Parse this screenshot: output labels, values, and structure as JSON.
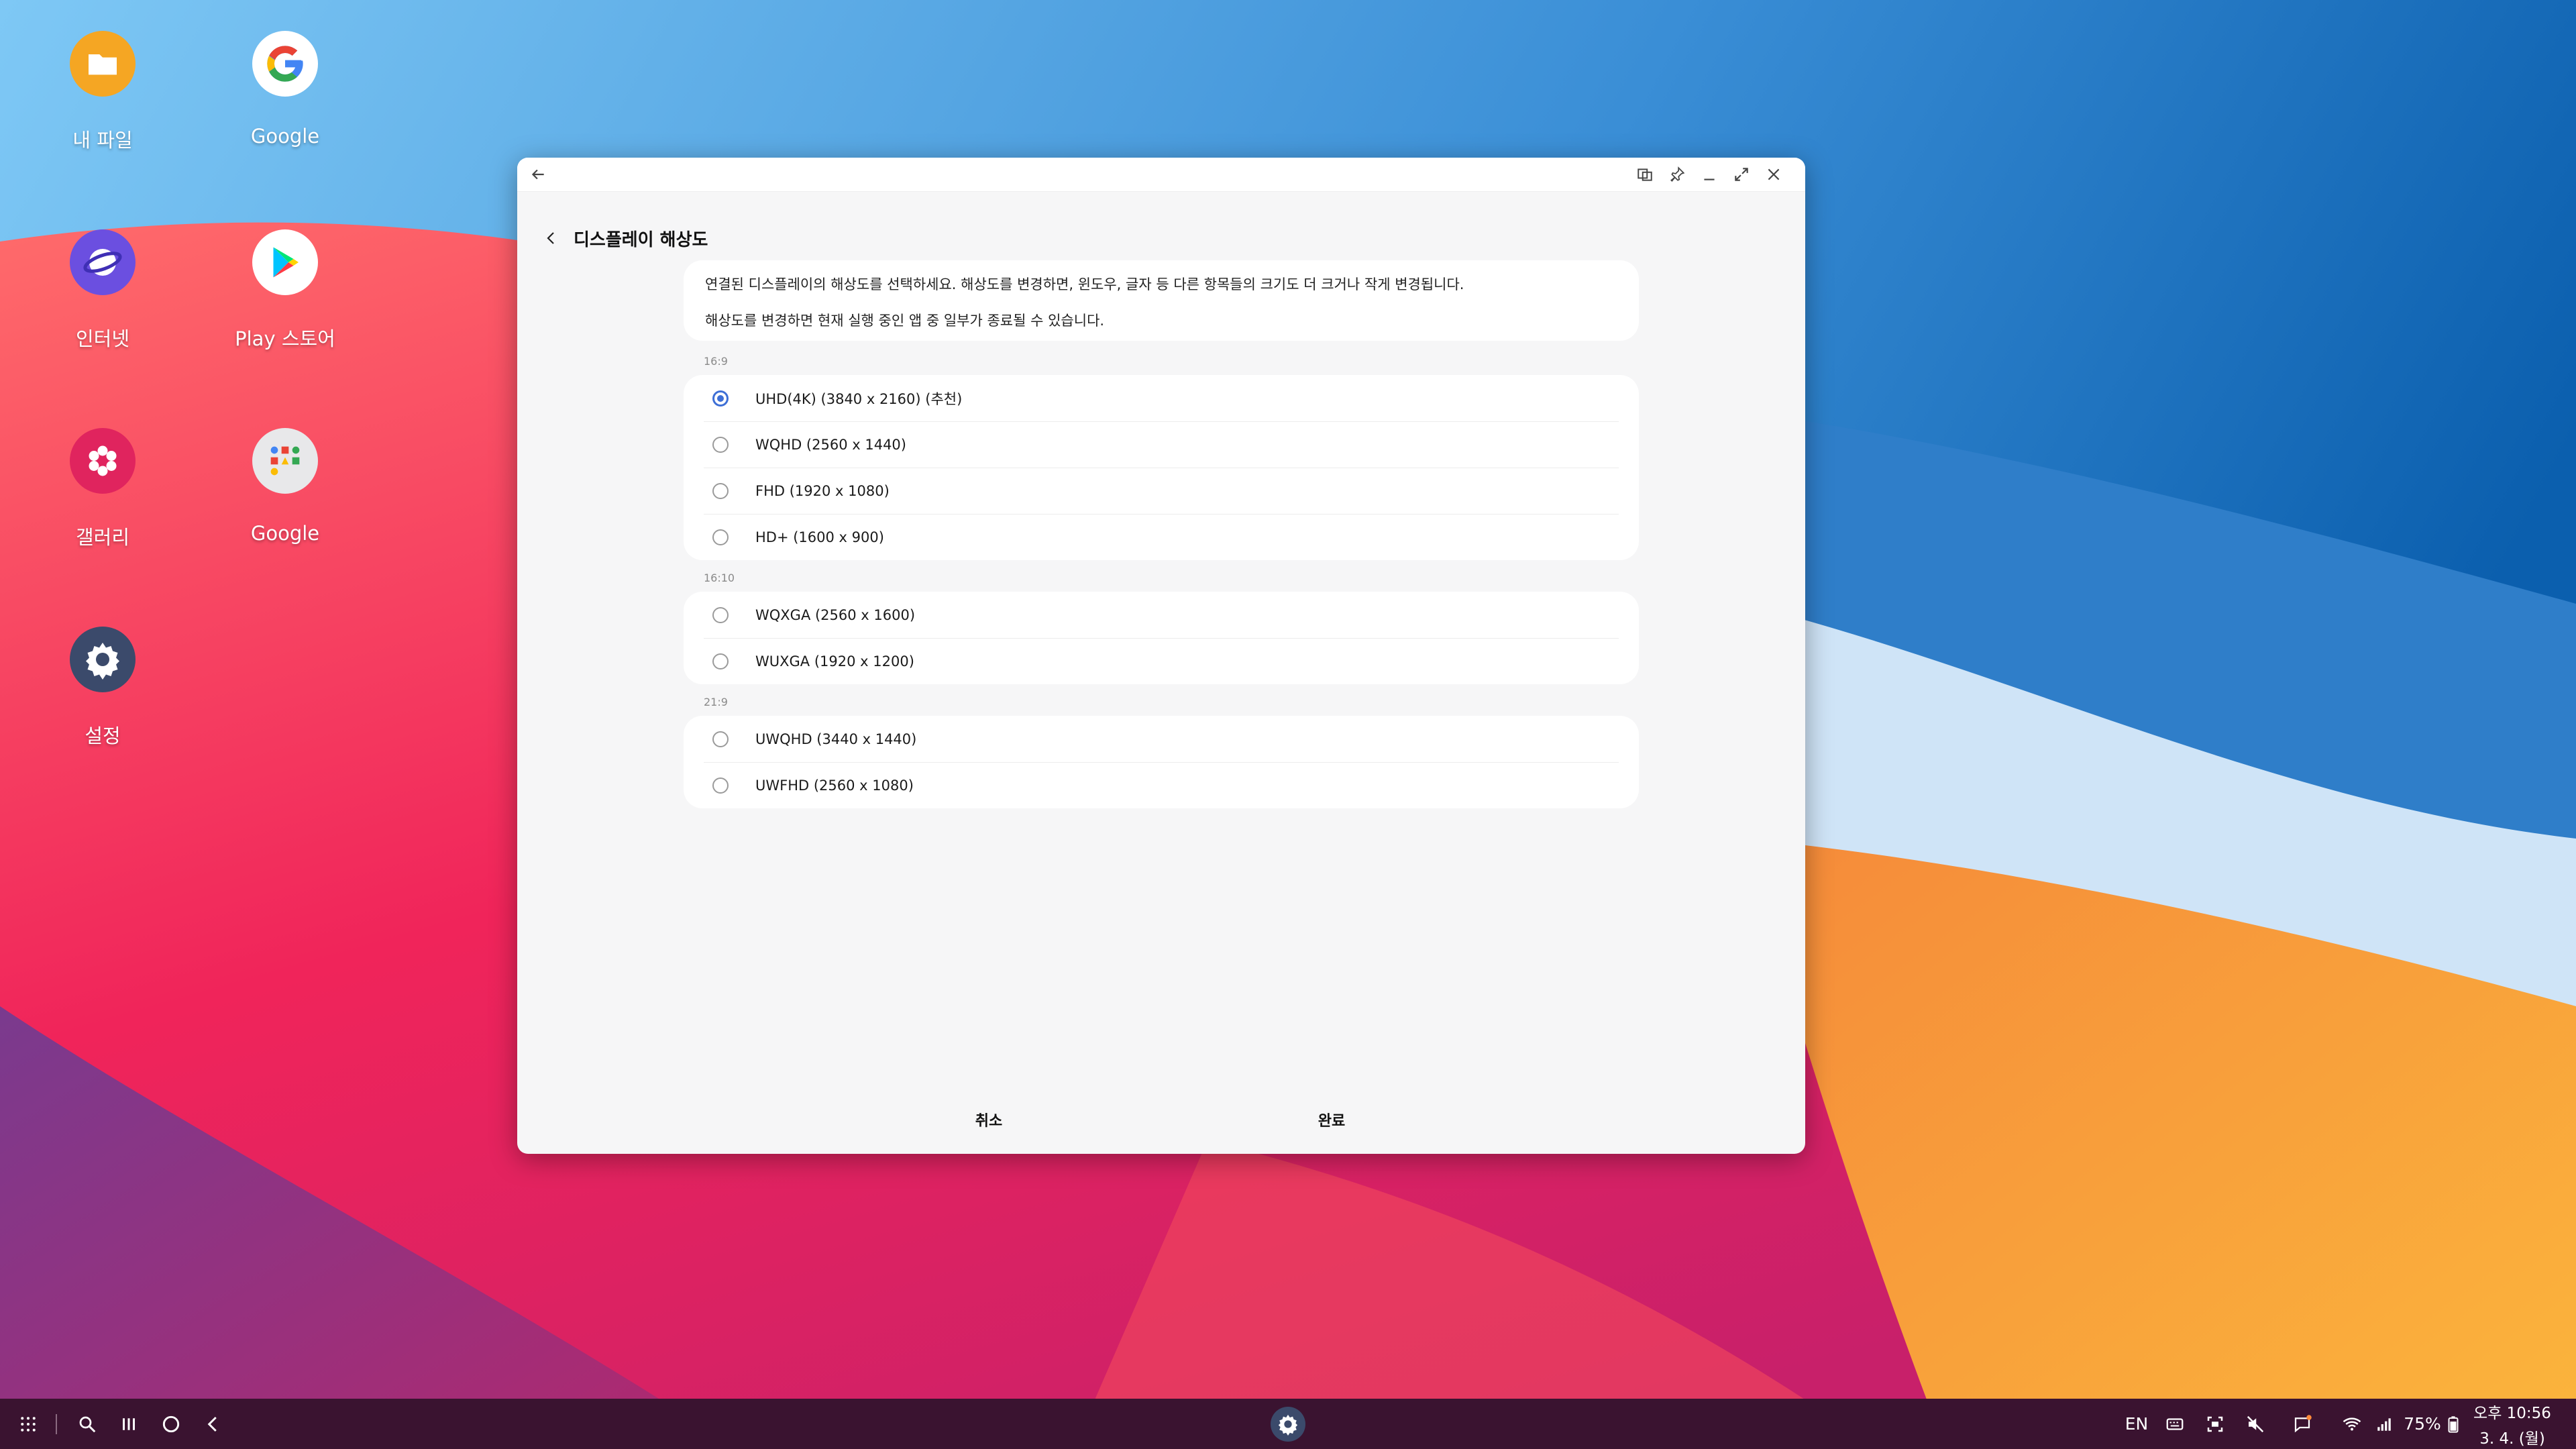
{
  "desktop": {
    "icons": [
      {
        "label": "내 파일",
        "icon": "folder-icon"
      },
      {
        "label": "Google",
        "icon": "google-g-icon"
      },
      {
        "label": "인터넷",
        "icon": "internet-browser-icon"
      },
      {
        "label": "Play 스토어",
        "icon": "play-store-icon"
      },
      {
        "label": "갤러리",
        "icon": "gallery-flower-icon"
      },
      {
        "label": "Google",
        "icon": "google-folder-icon"
      },
      {
        "label": "설정",
        "icon": "settings-gear-icon"
      }
    ]
  },
  "window": {
    "title": "디스플레이 해상도",
    "info": {
      "line1": "연결된 디스플레이의 해상도를 선택하세요. 해상도를 변경하면, 윈도우, 글자 등 다른 항목들의 크기도 더 크거나 작게 변경됩니다.",
      "line2": "해상도를 변경하면 현재 실행 중인 앱 중 일부가 종료될 수 있습니다."
    },
    "groups": [
      {
        "label": "16:9",
        "options": [
          {
            "label": "UHD(4K) (3840 x 2160) (추천)",
            "selected": true
          },
          {
            "label": "WQHD (2560 x 1440)",
            "selected": false
          },
          {
            "label": "FHD (1920 x 1080)",
            "selected": false
          },
          {
            "label": "HD+ (1600 x 900)",
            "selected": false
          }
        ]
      },
      {
        "label": "16:10",
        "options": [
          {
            "label": "WQXGA (2560 x 1600)",
            "selected": false
          },
          {
            "label": "WUXGA (1920 x 1200)",
            "selected": false
          }
        ]
      },
      {
        "label": "21:9",
        "options": [
          {
            "label": "UWQHD (3440 x 1440)",
            "selected": false
          },
          {
            "label": "UWFHD (2560 x 1080)",
            "selected": false
          }
        ]
      }
    ],
    "buttons": {
      "cancel": "취소",
      "done": "완료"
    }
  },
  "taskbar": {
    "language": "EN",
    "battery": "75%",
    "time": "오후 10:56",
    "date": "3. 4. (월)"
  },
  "colors": {
    "accent": "#3e6fd6",
    "taskbar": "#3a1330"
  }
}
